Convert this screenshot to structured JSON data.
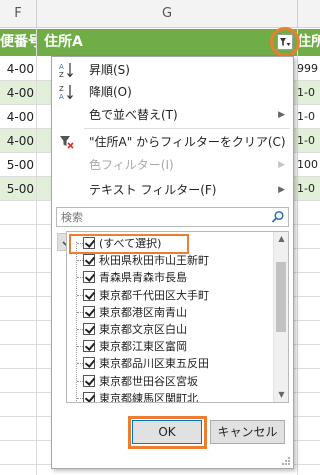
{
  "sheet": {
    "columns": [
      "F",
      "G"
    ],
    "header": {
      "left": "便番号",
      "main": "住所A",
      "right": "住所"
    },
    "rows": [
      {
        "left": "4-00",
        "right": "999",
        "style": "white"
      },
      {
        "left": "4-00",
        "right": "1-0",
        "style": "green"
      },
      {
        "left": "4-00",
        "right": "1-0",
        "style": "white"
      },
      {
        "left": "4-00",
        "right": "1-0",
        "style": "green"
      },
      {
        "left": "5-00",
        "right": "100",
        "style": "white"
      },
      {
        "left": "5-00",
        "right": "1-0",
        "style": "green"
      },
      {
        "left": "",
        "right": "",
        "style": "white"
      },
      {
        "left": "",
        "right": "",
        "style": "white"
      },
      {
        "left": "",
        "right": "",
        "style": "white"
      },
      {
        "left": "",
        "right": "",
        "style": "white"
      },
      {
        "left": "",
        "right": "",
        "style": "white"
      },
      {
        "left": "",
        "right": "",
        "style": "white"
      },
      {
        "left": "",
        "right": "",
        "style": "white"
      },
      {
        "left": "",
        "right": "",
        "style": "white"
      },
      {
        "left": "",
        "right": "",
        "style": "white"
      },
      {
        "left": "",
        "right": "",
        "style": "white"
      },
      {
        "left": "",
        "right": "",
        "style": "white"
      },
      {
        "left": "",
        "right": "",
        "style": "white"
      }
    ]
  },
  "menu": {
    "sort_asc": "昇順(S)",
    "sort_desc": "降順(O)",
    "sort_by_color": "色で並べ替え(T)",
    "clear_filter": "\"住所A\" からフィルターをクリア(C)",
    "color_filter": "色フィルター(I)",
    "text_filter": "テキスト フィルター(F)"
  },
  "search": {
    "placeholder": "検索"
  },
  "list": {
    "items": [
      "(すべて選択)",
      "秋田県秋田市山王新町",
      "青森県青森市長島",
      "東京都千代田区大手町",
      "東京都港区南青山",
      "東京都文京区白山",
      "東京都江東区富岡",
      "東京都品川区東五反田",
      "東京都世田谷区宮坂",
      "東京都練馬区関町北"
    ]
  },
  "buttons": {
    "ok": "OK",
    "cancel": "キャンセル"
  },
  "colors": {
    "accent": "#ed7d31",
    "header_green": "#70ad47",
    "band_green": "#e2efd9",
    "primary_button_border": "#0078d7"
  },
  "icons": {
    "filter": "filter-dropdown-icon",
    "sort_asc": "sort-az-icon",
    "sort_desc": "sort-za-icon",
    "clear_filter": "clear-filter-icon",
    "search": "magnifier-icon"
  }
}
